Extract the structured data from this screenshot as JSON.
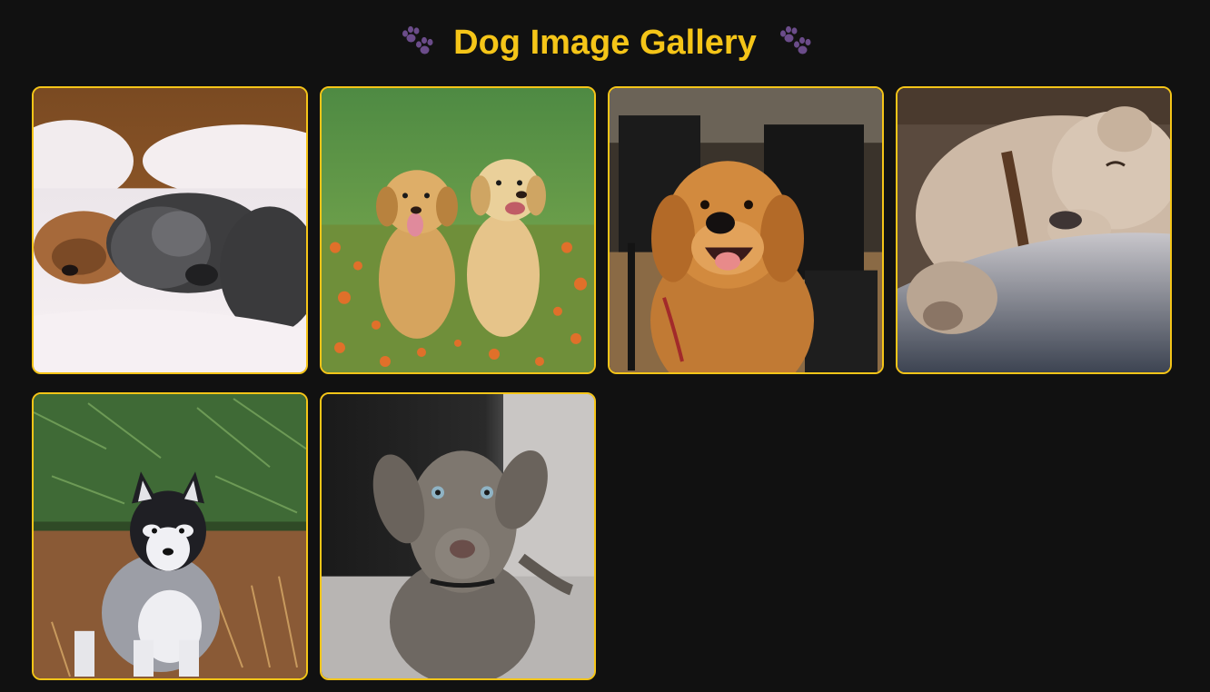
{
  "header": {
    "title": "Dog Image Gallery",
    "left_icon": "paw-prints-icon",
    "right_icon": "paw-prints-icon"
  },
  "colors": {
    "background": "#111111",
    "accent": "#f5c518",
    "paw": "#6b4c8a"
  },
  "gallery": {
    "images": [
      {
        "icon": "sleeping-dogs-photo"
      },
      {
        "icon": "golden-puppies-photo"
      },
      {
        "icon": "golden-retriever-photo"
      },
      {
        "icon": "sleeping-labrador-photo"
      },
      {
        "icon": "husky-puppy-photo"
      },
      {
        "icon": "weimaraner-puppy-photo"
      }
    ]
  }
}
